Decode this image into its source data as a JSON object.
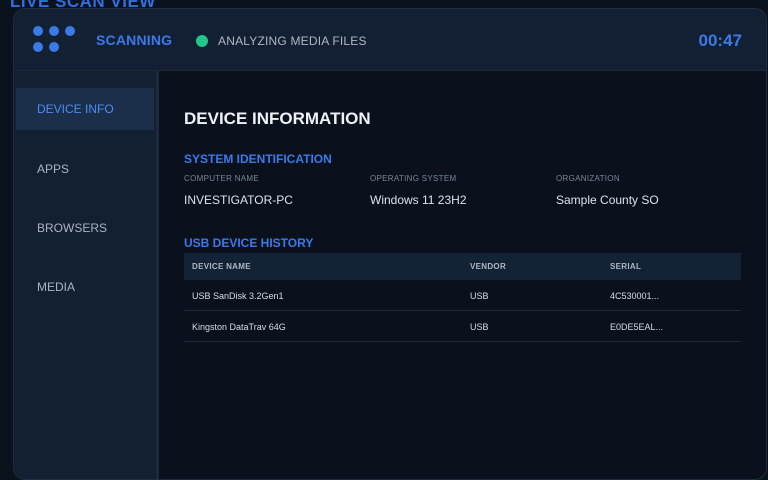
{
  "page": {
    "heading": "LIVE SCAN VIEW"
  },
  "header": {
    "status_label": "SCANNING",
    "status_detail": "ANALYZING MEDIA FILES",
    "timer": "00:47",
    "colors": {
      "accent": "#3a7be8",
      "status_ok": "#22c58a"
    },
    "icons": {
      "menu": "dots-grid-icon",
      "status": "status-dot-icon"
    }
  },
  "sidebar": {
    "items": [
      {
        "label": "DEVICE INFO",
        "active": true
      },
      {
        "label": "APPS",
        "active": false
      },
      {
        "label": "BROWSERS",
        "active": false
      },
      {
        "label": "MEDIA",
        "active": false
      }
    ]
  },
  "main": {
    "title": "DEVICE INFORMATION",
    "system": {
      "heading": "SYSTEM IDENTIFICATION",
      "fields": [
        {
          "label": "COMPUTER NAME",
          "value": "INVESTIGATOR-PC"
        },
        {
          "label": "OPERATING SYSTEM",
          "value": "Windows 11 23H2"
        },
        {
          "label": "ORGANIZATION",
          "value": "Sample County SO"
        }
      ]
    },
    "usb": {
      "heading": "USB DEVICE HISTORY",
      "columns": [
        "DEVICE NAME",
        "VENDOR",
        "SERIAL"
      ],
      "rows": [
        [
          "USB SanDisk 3.2Gen1",
          "USB",
          "4C530001..."
        ],
        [
          "Kingston DataTrav 64G",
          "USB",
          "E0DE5EAL..."
        ]
      ]
    }
  }
}
